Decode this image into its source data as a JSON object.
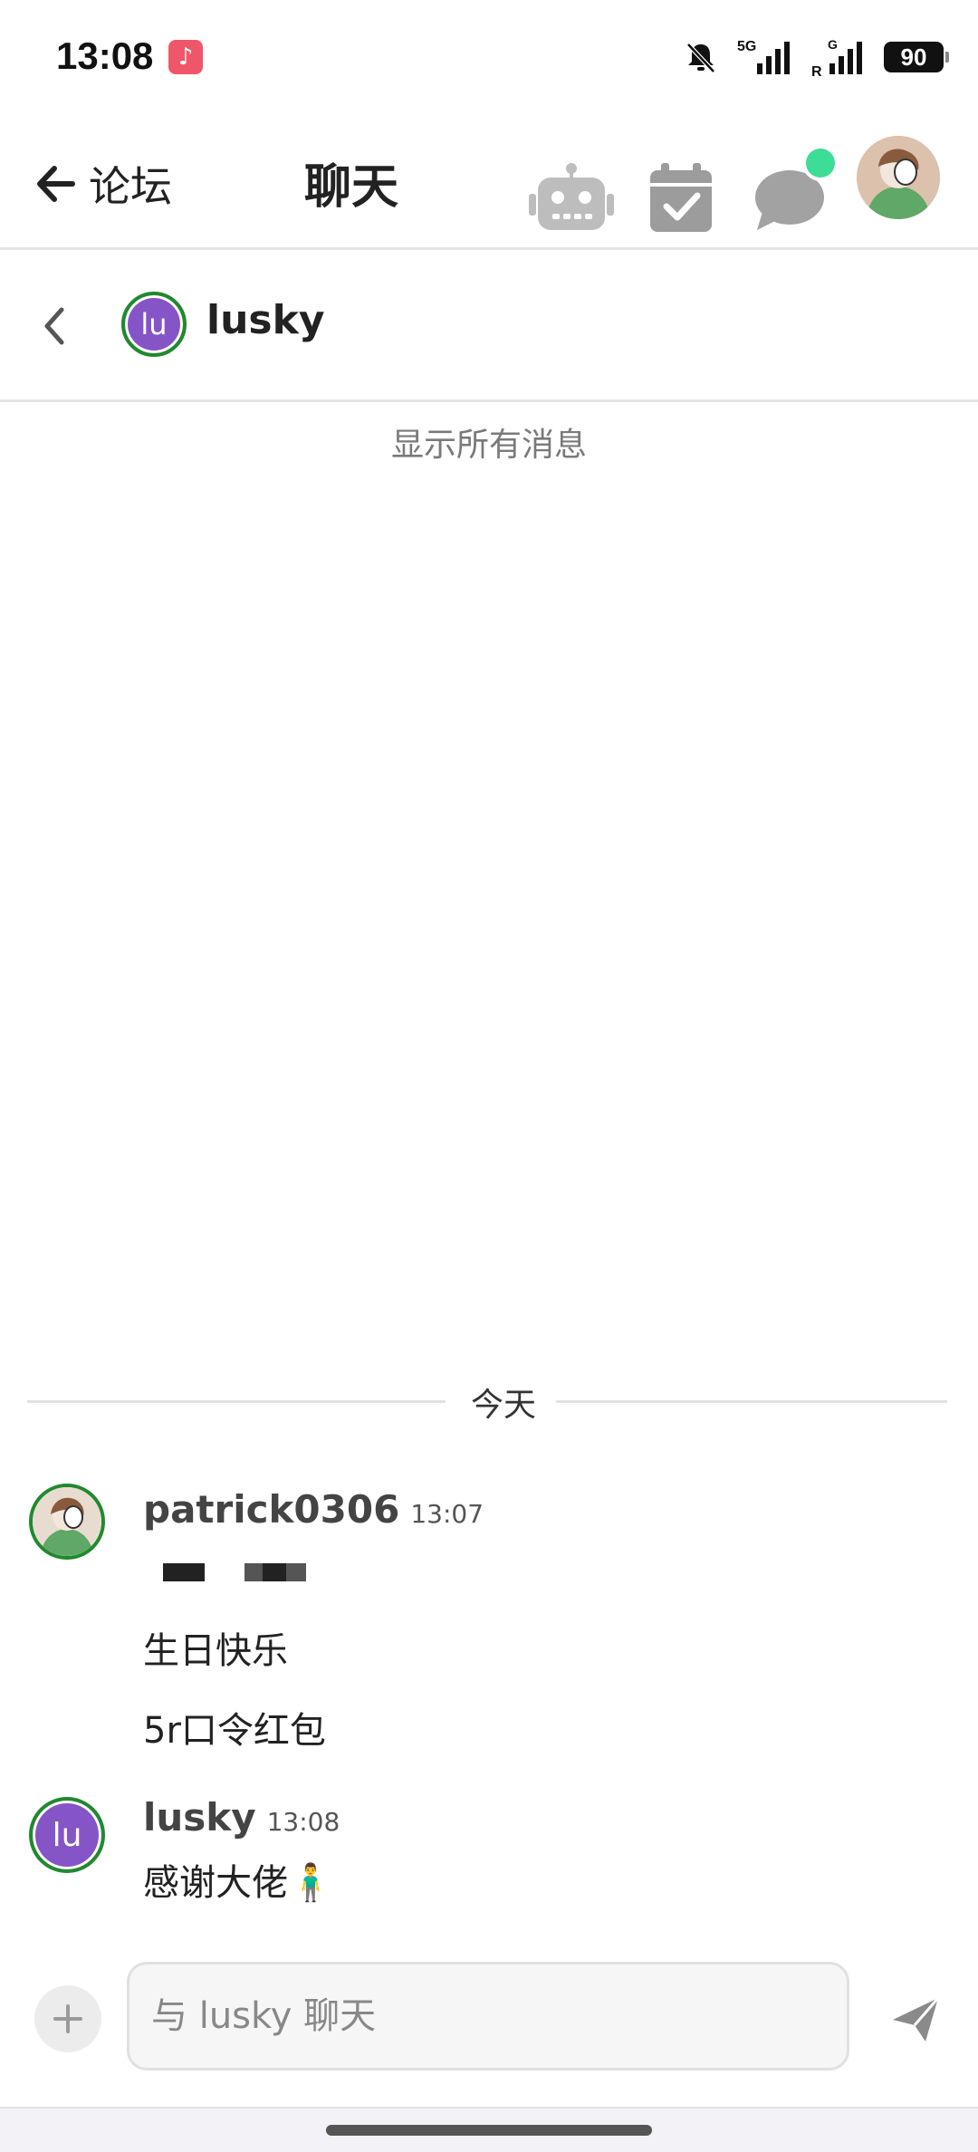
{
  "status_bar": {
    "time": "13:08",
    "battery": "90",
    "network_label": "5G",
    "icons": [
      "music-app-icon",
      "bell-off-icon",
      "signal-icon",
      "battery-icon"
    ]
  },
  "header": {
    "back_label": "论坛",
    "title": "聊天",
    "icons": [
      "robot-icon",
      "calendar-check-icon",
      "chat-bubble-icon",
      "avatar"
    ],
    "chat_badge_color": "#3ddc97"
  },
  "chat": {
    "partner_initials": "lu",
    "partner_name": "lusky",
    "show_all": "显示所有消息",
    "date_divider": "今天"
  },
  "messages": [
    {
      "user": "patrick0306",
      "time": "13:07",
      "lines": [
        "生日快乐",
        "5r口令红包"
      ]
    },
    {
      "user": "lusky",
      "initials": "lu",
      "time": "13:08",
      "lines": [
        "感谢大佬🧍‍♂️"
      ]
    }
  ],
  "composer": {
    "placeholder": "与 lusky 聊天",
    "value": ""
  },
  "colors": {
    "avatar_purple": "#8555c8",
    "online_ring": "#1f8a2e",
    "icon_gray": "#9c9c9c"
  }
}
